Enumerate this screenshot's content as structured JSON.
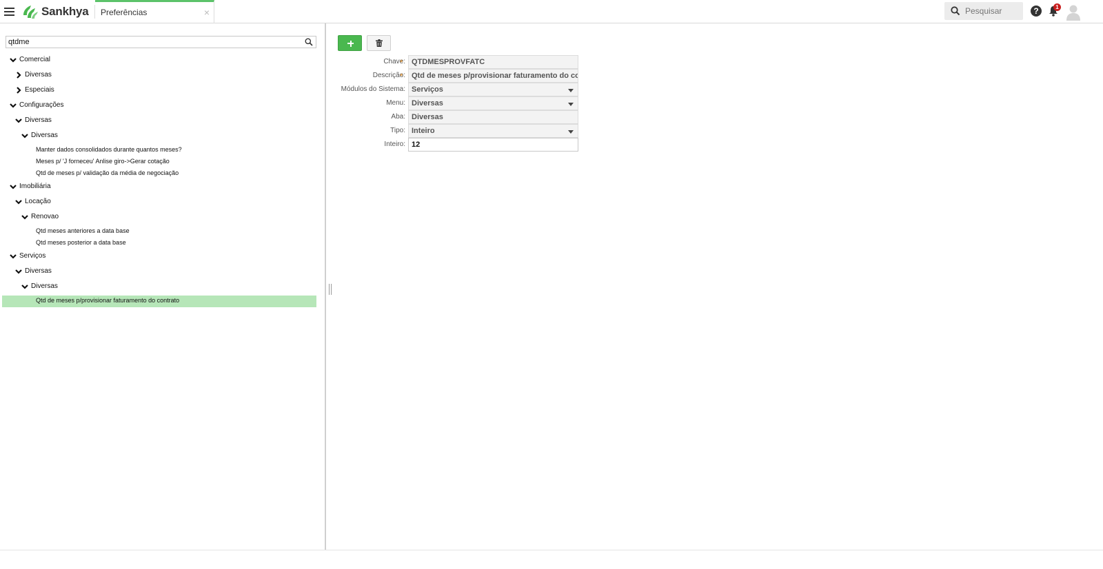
{
  "app": {
    "brand": "Sankhya",
    "brand_color": "#4ab84f"
  },
  "tab": {
    "label": "Preferências",
    "close": "×"
  },
  "header": {
    "search_placeholder": "Pesquisar",
    "help": "?",
    "notification_count": "1"
  },
  "tree": {
    "filter_value": "qtdme",
    "nodes": [
      {
        "label": "Comercial"
      },
      {
        "label": "Diversas"
      },
      {
        "label": "Especiais"
      },
      {
        "label": "Configurações"
      },
      {
        "label": "Diversas"
      },
      {
        "label": "Diversas"
      },
      {
        "label": "Manter dados consolidados durante quantos meses?"
      },
      {
        "label": "Meses p/ 'J forneceu' Anlise giro->Gerar cotação"
      },
      {
        "label": "Qtd de meses p/ validação da média de negociação"
      },
      {
        "label": "Imobiliária"
      },
      {
        "label": "Locação"
      },
      {
        "label": "Renovao"
      },
      {
        "label": "Qtd meses anteriores a data base"
      },
      {
        "label": "Qtd meses posterior a data base"
      },
      {
        "label": "Serviços"
      },
      {
        "label": "Diversas"
      },
      {
        "label": "Diversas"
      },
      {
        "label": "Qtd de meses p/provisionar faturamento do contrato"
      }
    ]
  },
  "form": {
    "chave": {
      "label": "Chave:",
      "value": "QTDMESPROVFATC"
    },
    "descricao": {
      "label": "Descrição:",
      "value": "Qtd de meses p/provisionar faturamento do cor"
    },
    "modulos": {
      "label": "Módulos do Sistema:",
      "value": "Serviços"
    },
    "menu": {
      "label": "Menu:",
      "value": "Diversas"
    },
    "aba": {
      "label": "Aba:",
      "value": "Diversas"
    },
    "tipo": {
      "label": "Tipo:",
      "value": "Inteiro"
    },
    "inteiro": {
      "label": "Inteiro:",
      "value": "12"
    },
    "required_mark": "*"
  }
}
